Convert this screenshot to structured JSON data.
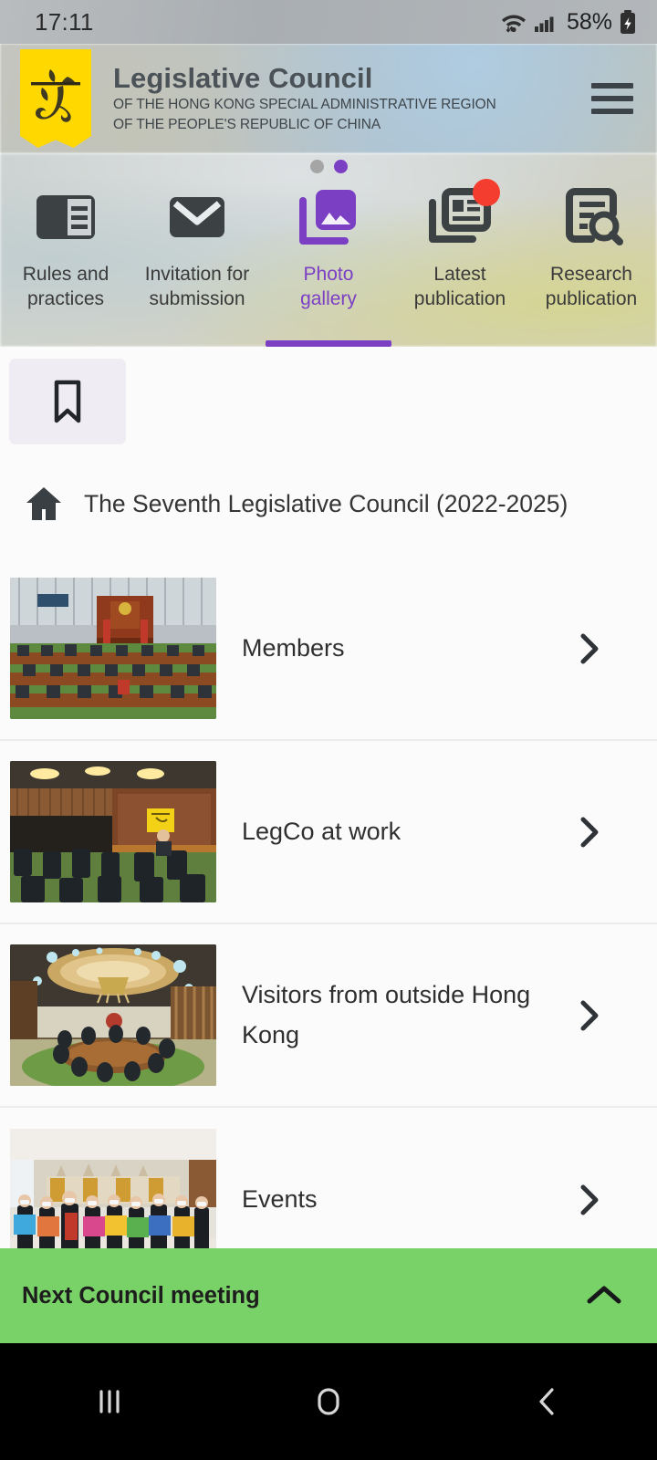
{
  "status_bar": {
    "time": "17:11",
    "battery_percent": "58%",
    "icons": [
      "wifi-icon",
      "cellular-signal-icon",
      "battery-charging-icon"
    ]
  },
  "header": {
    "logo_alt": "legco-logo",
    "title": "Legislative Council",
    "subtitle_line1": "OF THE HONG KONG SPECIAL ADMINISTRATIVE REGION",
    "subtitle_line2": "OF THE PEOPLE'S REPUBLIC OF CHINA",
    "menu_icon": "hamburger-menu-icon"
  },
  "tab_bar": {
    "pager_dots": [
      {
        "state": "inactive",
        "color": "#a5a5a5"
      },
      {
        "state": "active",
        "color": "#7b3fc4"
      }
    ],
    "accent_color": "#7b3fc4",
    "badge_color": "#f43d2e",
    "tabs": [
      {
        "label_line1": "Rules and",
        "label_line2": "practices",
        "icon": "article-book-icon",
        "active": false,
        "badge": false
      },
      {
        "label_line1": "Invitation for",
        "label_line2": "submission",
        "icon": "envelope-mail-icon",
        "active": false,
        "badge": false
      },
      {
        "label_line1": "Photo",
        "label_line2": "gallery",
        "icon": "photo-library-icon",
        "active": true,
        "badge": false
      },
      {
        "label_line1": "Latest",
        "label_line2": "publication",
        "icon": "newspaper-icon",
        "active": false,
        "badge": true
      },
      {
        "label_line1": "Research",
        "label_line2": "publication",
        "icon": "document-search-icon",
        "active": false,
        "badge": false
      }
    ]
  },
  "content": {
    "bookmark_icon": "bookmark-icon",
    "breadcrumb": {
      "home_icon": "home-icon",
      "text": "The Seventh Legislative Council (2022-2025)"
    },
    "rows": [
      {
        "label": "Members",
        "thumb": "legco-chamber-members-photo",
        "chevron": "chevron-right-icon"
      },
      {
        "label": "LegCo at work",
        "thumb": "legco-chamber-press-photo",
        "chevron": "chevron-right-icon"
      },
      {
        "label": "Visitors from outside Hong Kong",
        "thumb": "legco-conference-room-photo",
        "chevron": "chevron-right-icon"
      },
      {
        "label": "Events",
        "thumb": "legco-event-group-photo",
        "chevron": "chevron-right-icon"
      }
    ]
  },
  "footer": {
    "label": "Next Council meeting",
    "expand_icon": "chevron-up-icon",
    "background_color": "#79d267"
  },
  "system_nav": {
    "recents_icon": "recents-icon",
    "home_icon": "home-square-icon",
    "back_icon": "back-chevron-icon"
  }
}
